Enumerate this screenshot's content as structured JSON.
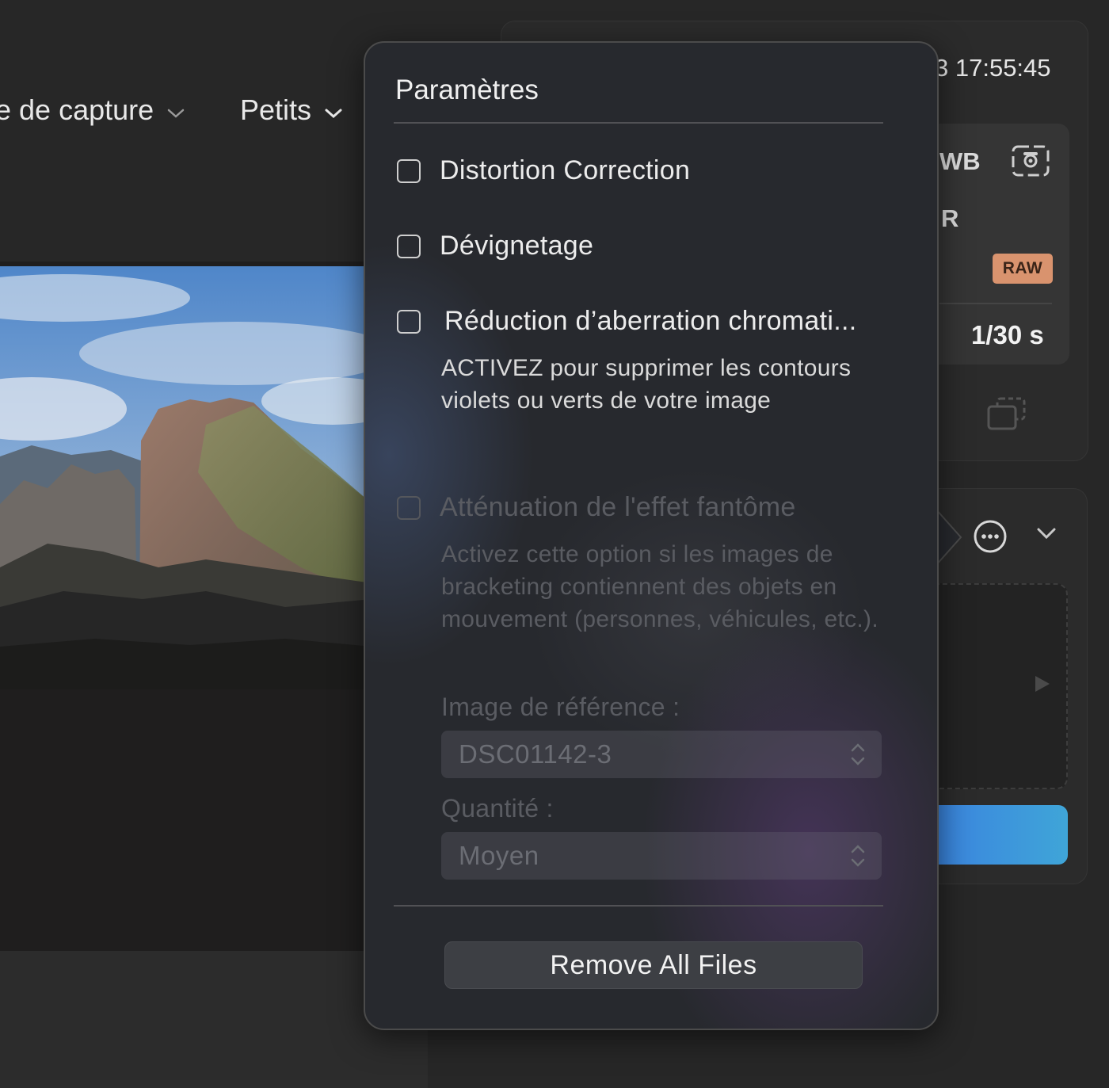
{
  "toolbar": {
    "capture_dropdown": "e de capture",
    "size_dropdown": "Petits"
  },
  "metadata_panel": {
    "datetime": "3 17:55:45",
    "wb_label": "WB",
    "r_label": "R",
    "raw_badge": "RAW",
    "shutter_speed": "1/30 s"
  },
  "icons": {
    "camera": "camera-icon",
    "stack": "stack-icon",
    "more": "more-circle-icon",
    "chevron": "chevron-down-icon",
    "play": "play-icon",
    "updown": "updown-chevron-icon"
  },
  "popover": {
    "title": "Paramètres",
    "options": {
      "distortion": {
        "label": "Distortion Correction",
        "checked": false
      },
      "devignetting": {
        "label": "Dévignetage",
        "checked": false
      },
      "chromatic": {
        "label": "Réduction d’aberration chromati...",
        "checked": false,
        "description": "ACTIVEZ pour supprimer les contours violets ou verts de votre image"
      },
      "ghosting": {
        "label": "Atténuation de l'effet fantôme",
        "checked": false,
        "enabled": false,
        "description": "Activez cette option si les images de bracketing contiennent des objets en mouvement (personnes, véhicules, etc.)."
      }
    },
    "reference_image": {
      "label": "Image de référence :",
      "value": "DSC01142-3"
    },
    "amount": {
      "label": "Quantité :",
      "value": "Moyen"
    },
    "remove_button": "Remove All Files"
  },
  "colors": {
    "accent_blue": "#3a7ee0",
    "raw_badge": "#d9936e"
  }
}
